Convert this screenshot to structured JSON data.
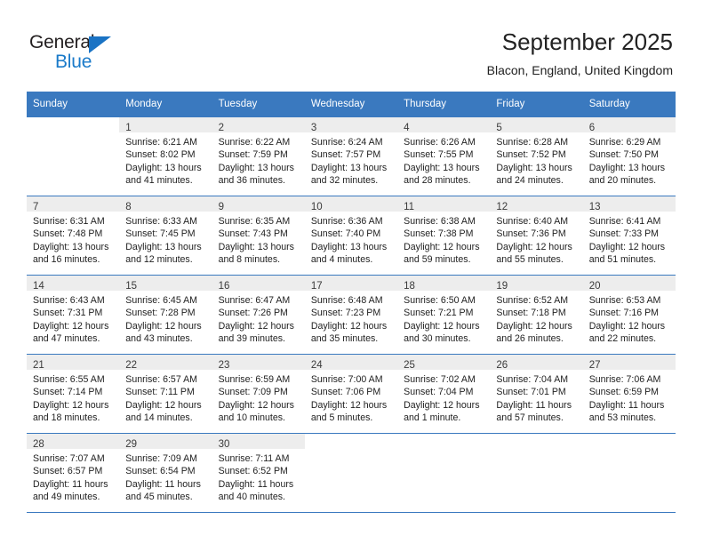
{
  "brand": {
    "name_part1": "General",
    "name_part2": "Blue",
    "accent_color": "#1a7ac9",
    "header_color": "#3a79bf"
  },
  "header": {
    "title": "September 2025",
    "subtitle": "Blacon, England, United Kingdom"
  },
  "calendar": {
    "weekday_headers": [
      "Sunday",
      "Monday",
      "Tuesday",
      "Wednesday",
      "Thursday",
      "Friday",
      "Saturday"
    ],
    "weeks": [
      [
        {
          "day": "",
          "sunrise": "",
          "sunset": "",
          "daylight1": "",
          "daylight2": ""
        },
        {
          "day": "1",
          "sunrise": "Sunrise: 6:21 AM",
          "sunset": "Sunset: 8:02 PM",
          "daylight1": "Daylight: 13 hours",
          "daylight2": "and 41 minutes."
        },
        {
          "day": "2",
          "sunrise": "Sunrise: 6:22 AM",
          "sunset": "Sunset: 7:59 PM",
          "daylight1": "Daylight: 13 hours",
          "daylight2": "and 36 minutes."
        },
        {
          "day": "3",
          "sunrise": "Sunrise: 6:24 AM",
          "sunset": "Sunset: 7:57 PM",
          "daylight1": "Daylight: 13 hours",
          "daylight2": "and 32 minutes."
        },
        {
          "day": "4",
          "sunrise": "Sunrise: 6:26 AM",
          "sunset": "Sunset: 7:55 PM",
          "daylight1": "Daylight: 13 hours",
          "daylight2": "and 28 minutes."
        },
        {
          "day": "5",
          "sunrise": "Sunrise: 6:28 AM",
          "sunset": "Sunset: 7:52 PM",
          "daylight1": "Daylight: 13 hours",
          "daylight2": "and 24 minutes."
        },
        {
          "day": "6",
          "sunrise": "Sunrise: 6:29 AM",
          "sunset": "Sunset: 7:50 PM",
          "daylight1": "Daylight: 13 hours",
          "daylight2": "and 20 minutes."
        }
      ],
      [
        {
          "day": "7",
          "sunrise": "Sunrise: 6:31 AM",
          "sunset": "Sunset: 7:48 PM",
          "daylight1": "Daylight: 13 hours",
          "daylight2": "and 16 minutes."
        },
        {
          "day": "8",
          "sunrise": "Sunrise: 6:33 AM",
          "sunset": "Sunset: 7:45 PM",
          "daylight1": "Daylight: 13 hours",
          "daylight2": "and 12 minutes."
        },
        {
          "day": "9",
          "sunrise": "Sunrise: 6:35 AM",
          "sunset": "Sunset: 7:43 PM",
          "daylight1": "Daylight: 13 hours",
          "daylight2": "and 8 minutes."
        },
        {
          "day": "10",
          "sunrise": "Sunrise: 6:36 AM",
          "sunset": "Sunset: 7:40 PM",
          "daylight1": "Daylight: 13 hours",
          "daylight2": "and 4 minutes."
        },
        {
          "day": "11",
          "sunrise": "Sunrise: 6:38 AM",
          "sunset": "Sunset: 7:38 PM",
          "daylight1": "Daylight: 12 hours",
          "daylight2": "and 59 minutes."
        },
        {
          "day": "12",
          "sunrise": "Sunrise: 6:40 AM",
          "sunset": "Sunset: 7:36 PM",
          "daylight1": "Daylight: 12 hours",
          "daylight2": "and 55 minutes."
        },
        {
          "day": "13",
          "sunrise": "Sunrise: 6:41 AM",
          "sunset": "Sunset: 7:33 PM",
          "daylight1": "Daylight: 12 hours",
          "daylight2": "and 51 minutes."
        }
      ],
      [
        {
          "day": "14",
          "sunrise": "Sunrise: 6:43 AM",
          "sunset": "Sunset: 7:31 PM",
          "daylight1": "Daylight: 12 hours",
          "daylight2": "and 47 minutes."
        },
        {
          "day": "15",
          "sunrise": "Sunrise: 6:45 AM",
          "sunset": "Sunset: 7:28 PM",
          "daylight1": "Daylight: 12 hours",
          "daylight2": "and 43 minutes."
        },
        {
          "day": "16",
          "sunrise": "Sunrise: 6:47 AM",
          "sunset": "Sunset: 7:26 PM",
          "daylight1": "Daylight: 12 hours",
          "daylight2": "and 39 minutes."
        },
        {
          "day": "17",
          "sunrise": "Sunrise: 6:48 AM",
          "sunset": "Sunset: 7:23 PM",
          "daylight1": "Daylight: 12 hours",
          "daylight2": "and 35 minutes."
        },
        {
          "day": "18",
          "sunrise": "Sunrise: 6:50 AM",
          "sunset": "Sunset: 7:21 PM",
          "daylight1": "Daylight: 12 hours",
          "daylight2": "and 30 minutes."
        },
        {
          "day": "19",
          "sunrise": "Sunrise: 6:52 AM",
          "sunset": "Sunset: 7:18 PM",
          "daylight1": "Daylight: 12 hours",
          "daylight2": "and 26 minutes."
        },
        {
          "day": "20",
          "sunrise": "Sunrise: 6:53 AM",
          "sunset": "Sunset: 7:16 PM",
          "daylight1": "Daylight: 12 hours",
          "daylight2": "and 22 minutes."
        }
      ],
      [
        {
          "day": "21",
          "sunrise": "Sunrise: 6:55 AM",
          "sunset": "Sunset: 7:14 PM",
          "daylight1": "Daylight: 12 hours",
          "daylight2": "and 18 minutes."
        },
        {
          "day": "22",
          "sunrise": "Sunrise: 6:57 AM",
          "sunset": "Sunset: 7:11 PM",
          "daylight1": "Daylight: 12 hours",
          "daylight2": "and 14 minutes."
        },
        {
          "day": "23",
          "sunrise": "Sunrise: 6:59 AM",
          "sunset": "Sunset: 7:09 PM",
          "daylight1": "Daylight: 12 hours",
          "daylight2": "and 10 minutes."
        },
        {
          "day": "24",
          "sunrise": "Sunrise: 7:00 AM",
          "sunset": "Sunset: 7:06 PM",
          "daylight1": "Daylight: 12 hours",
          "daylight2": "and 5 minutes."
        },
        {
          "day": "25",
          "sunrise": "Sunrise: 7:02 AM",
          "sunset": "Sunset: 7:04 PM",
          "daylight1": "Daylight: 12 hours",
          "daylight2": "and 1 minute."
        },
        {
          "day": "26",
          "sunrise": "Sunrise: 7:04 AM",
          "sunset": "Sunset: 7:01 PM",
          "daylight1": "Daylight: 11 hours",
          "daylight2": "and 57 minutes."
        },
        {
          "day": "27",
          "sunrise": "Sunrise: 7:06 AM",
          "sunset": "Sunset: 6:59 PM",
          "daylight1": "Daylight: 11 hours",
          "daylight2": "and 53 minutes."
        }
      ],
      [
        {
          "day": "28",
          "sunrise": "Sunrise: 7:07 AM",
          "sunset": "Sunset: 6:57 PM",
          "daylight1": "Daylight: 11 hours",
          "daylight2": "and 49 minutes."
        },
        {
          "day": "29",
          "sunrise": "Sunrise: 7:09 AM",
          "sunset": "Sunset: 6:54 PM",
          "daylight1": "Daylight: 11 hours",
          "daylight2": "and 45 minutes."
        },
        {
          "day": "30",
          "sunrise": "Sunrise: 7:11 AM",
          "sunset": "Sunset: 6:52 PM",
          "daylight1": "Daylight: 11 hours",
          "daylight2": "and 40 minutes."
        },
        {
          "day": "",
          "sunrise": "",
          "sunset": "",
          "daylight1": "",
          "daylight2": ""
        },
        {
          "day": "",
          "sunrise": "",
          "sunset": "",
          "daylight1": "",
          "daylight2": ""
        },
        {
          "day": "",
          "sunrise": "",
          "sunset": "",
          "daylight1": "",
          "daylight2": ""
        },
        {
          "day": "",
          "sunrise": "",
          "sunset": "",
          "daylight1": "",
          "daylight2": ""
        }
      ]
    ]
  }
}
